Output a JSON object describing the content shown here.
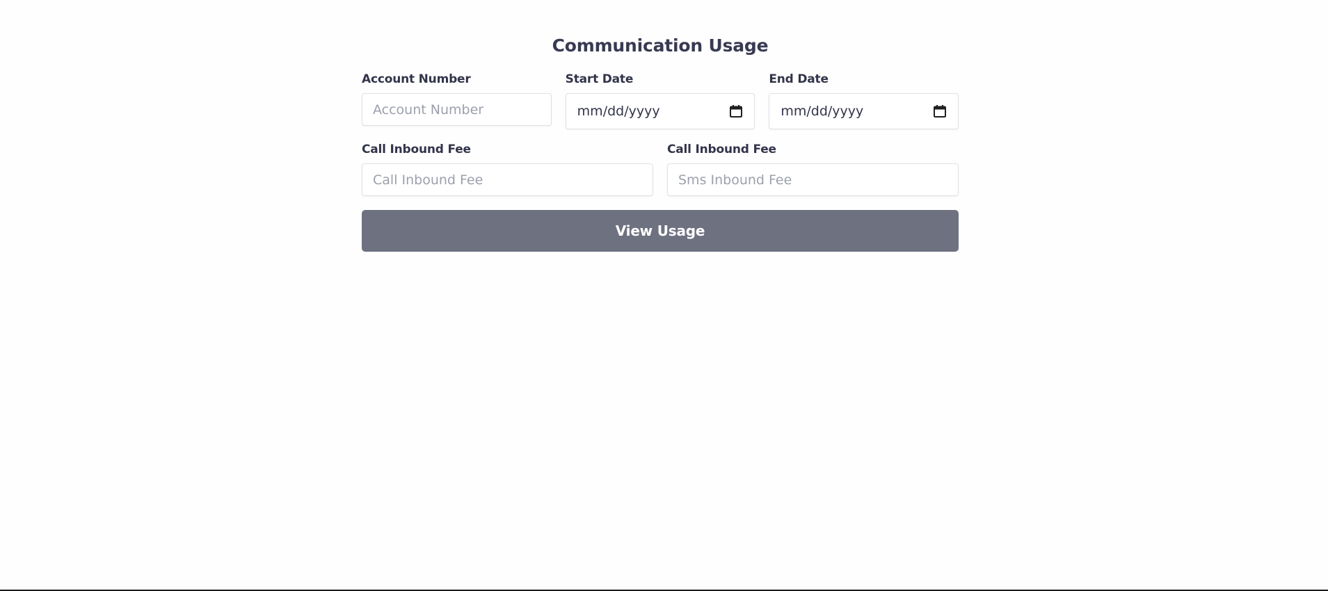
{
  "page": {
    "title": "Communication Usage"
  },
  "form": {
    "account_number": {
      "label": "Account Number",
      "placeholder": "Account Number",
      "value": ""
    },
    "start_date": {
      "label": "Start Date",
      "display": "mm/dd/yyyy"
    },
    "end_date": {
      "label": "End Date",
      "display": "mm/dd/yyyy"
    },
    "call_inbound_fee": {
      "label": "Call Inbound Fee",
      "placeholder": "Call Inbound Fee",
      "value": ""
    },
    "sms_inbound_fee": {
      "label": "Call Inbound Fee",
      "placeholder": "Sms Inbound Fee",
      "value": ""
    },
    "submit_label": "View Usage"
  },
  "icons": {
    "start_date_picker": "calendar-icon",
    "end_date_picker": "calendar-icon"
  },
  "colors": {
    "button_bg": "#6e7180",
    "text": "#32344a",
    "placeholder": "#9ca0ac",
    "border": "#dfe0e6"
  }
}
